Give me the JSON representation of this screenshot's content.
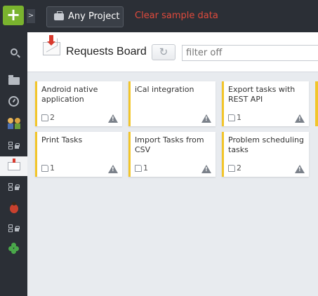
{
  "topbar": {
    "add_label": "+",
    "expand_label": ">",
    "project_label": "Any Project",
    "clear_label": "Clear sample data"
  },
  "sidebar": {
    "items": [
      {
        "icon": "search-icon"
      },
      {
        "icon": "folder-icon"
      },
      {
        "icon": "gauge-icon"
      },
      {
        "icon": "people-icon"
      },
      {
        "icon": "locked-board-icon"
      },
      {
        "icon": "mail-icon",
        "active": true
      },
      {
        "icon": "locked-board-icon"
      },
      {
        "icon": "bug-icon"
      },
      {
        "icon": "locked-board-icon"
      },
      {
        "icon": "clover-icon"
      }
    ]
  },
  "header": {
    "title": "Requests Board",
    "refresh_label": "↻",
    "filter_placeholder": "filter off"
  },
  "cards": [
    {
      "title": "Android native application",
      "votes": "2"
    },
    {
      "title": "iCal integration",
      "votes": ""
    },
    {
      "title": "Export tasks with REST API",
      "votes": "1"
    },
    {
      "title": "Print Tasks",
      "votes": "1"
    },
    {
      "title": "Import Tasks from CSV",
      "votes": "1"
    },
    {
      "title": "Problem scheduling tasks",
      "votes": "2"
    }
  ],
  "colors": {
    "accent_add": "#7ab32e",
    "clear_link": "#e04a3c",
    "card_border": "#f2c52a",
    "sidebar_bg": "#2b2f36"
  }
}
